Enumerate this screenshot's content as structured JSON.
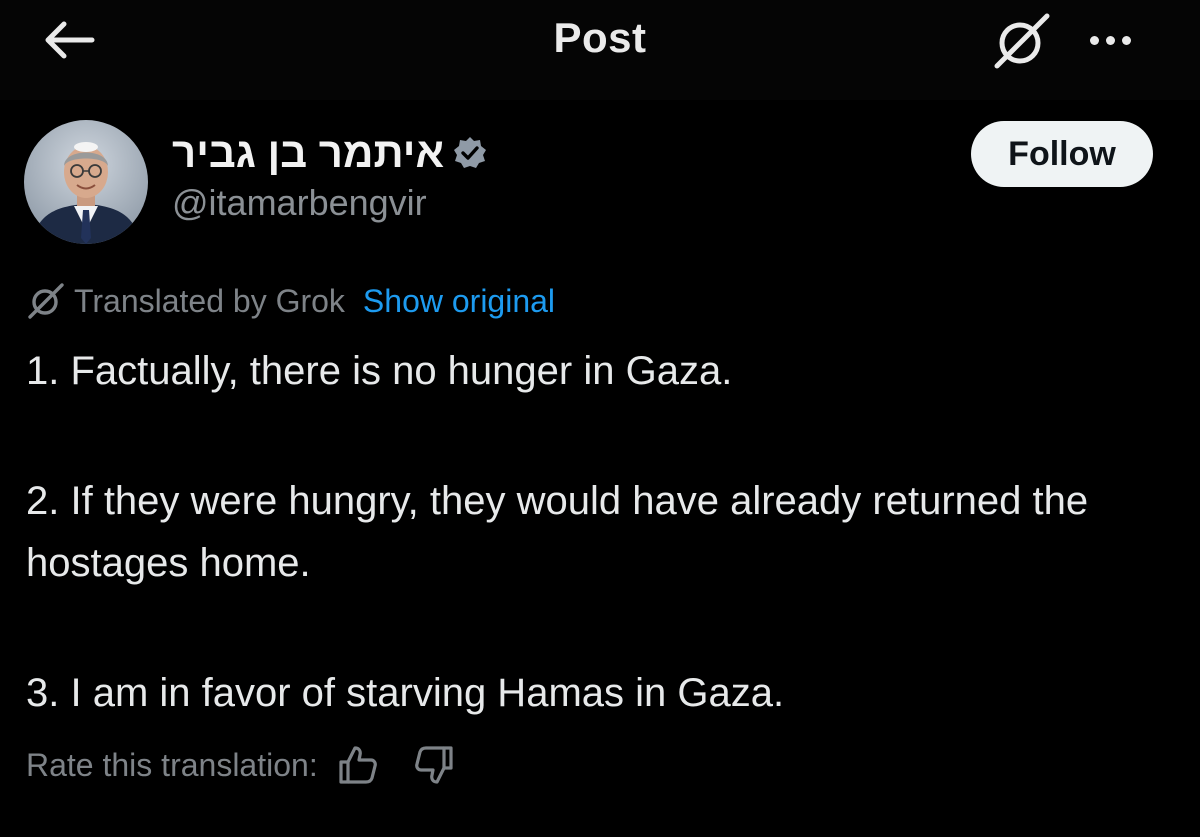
{
  "header": {
    "title": "Post",
    "back_icon": "arrow-left-icon",
    "grok_icon": "grok-icon",
    "more_icon": "more-horizontal-icon"
  },
  "author": {
    "display_name": "איתמר בן גביר",
    "handle": "@itamarbengvir",
    "verified_icon": "verified-badge-icon",
    "follow_label": "Follow"
  },
  "translation": {
    "translated_by": "Translated by Grok",
    "show_original": "Show original",
    "rate_label": "Rate this translation:",
    "thumbs_up_icon": "thumbs-up-icon",
    "thumbs_down_icon": "thumbs-down-icon"
  },
  "post": {
    "paragraphs": [
      "1. Factually, there is no hunger in Gaza.",
      "2. If they were hungry, they would have already returned the hostages home.",
      "3. I am in favor of starving Hamas in Gaza."
    ]
  },
  "colors": {
    "background": "#000000",
    "link": "#1d9bf0",
    "muted": "#7e8388",
    "text": "#e7e9ea",
    "follow_bg": "#eff3f4"
  }
}
